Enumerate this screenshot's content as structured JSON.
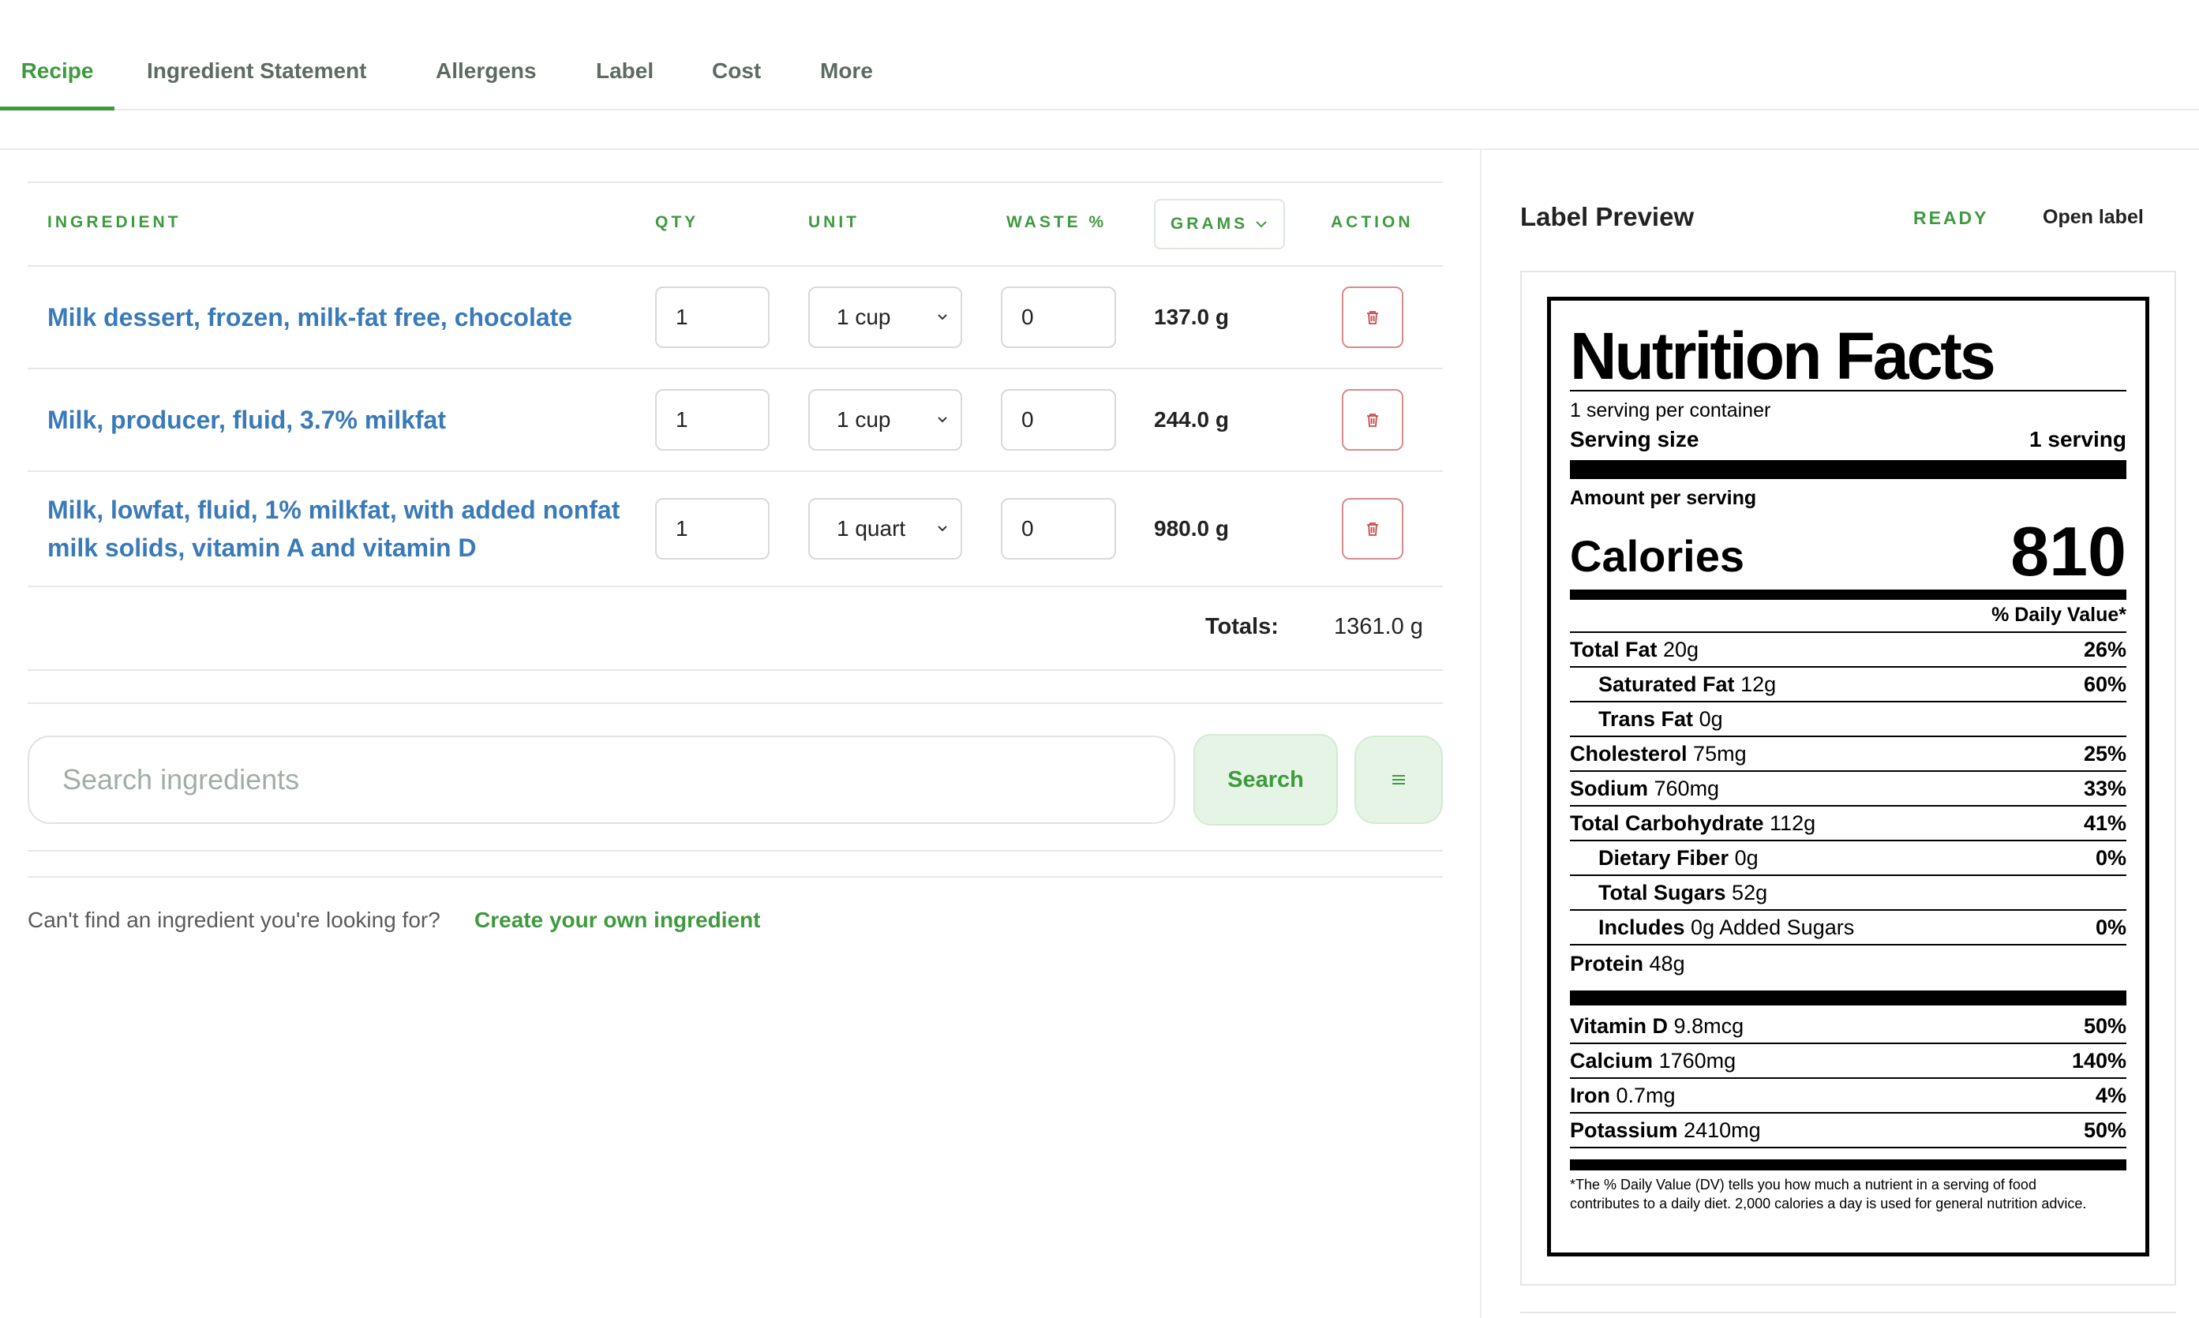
{
  "tabs": [
    {
      "label": "Recipe",
      "active": true
    },
    {
      "label": "Ingredient Statement"
    },
    {
      "label": "Allergens"
    },
    {
      "label": "Label"
    },
    {
      "label": "Cost"
    },
    {
      "label": "More"
    }
  ],
  "table": {
    "headers": {
      "ingredient": "INGREDIENT",
      "qty": "QTY",
      "unit": "UNIT",
      "waste": "WASTE %",
      "grams": "GRAMS",
      "action": "ACTION"
    },
    "rows": [
      {
        "name": "Milk dessert, frozen, milk-fat free, chocolate",
        "qty": "1",
        "unit": "1 cup",
        "waste": "0",
        "grams": "137.0 g"
      },
      {
        "name": "Milk, producer, fluid, 3.7% milkfat",
        "qty": "1",
        "unit": "1 cup",
        "waste": "0",
        "grams": "244.0 g"
      },
      {
        "name_line1": "Milk, lowfat, fluid, 1% milkfat, with added nonfat",
        "name_line2": "milk solids, vitamin A and vitamin D",
        "qty": "1",
        "unit": "1 quart",
        "waste": "0",
        "grams": "980.0 g"
      }
    ],
    "totals_label": "Totals:",
    "totals_value": "1361.0 g"
  },
  "search": {
    "placeholder": "Search ingredients",
    "button_label": "Search"
  },
  "footer": {
    "prompt": "Can't find an ingredient you're looking for?",
    "link": "Create your own ingredient"
  },
  "preview": {
    "title": "Label Preview",
    "status": "READY",
    "open_label": "Open label"
  },
  "nutrition": {
    "title": "Nutrition Facts",
    "servings": "1 serving per container",
    "serving_size_label": "Serving size",
    "serving_size_value": "1 serving",
    "amount_per_serving": "Amount per serving",
    "calories_label": "Calories",
    "calories_value": "810",
    "dv_header": "% Daily Value*",
    "rows": [
      {
        "name": "Total Fat",
        "amount": "20g",
        "dv": "26%"
      },
      {
        "name": "Saturated Fat",
        "amount": "12g",
        "dv": "60%"
      },
      {
        "name": "Trans Fat",
        "amount": "0g",
        "dv": ""
      },
      {
        "name": "Cholesterol",
        "amount": "75mg",
        "dv": "25%"
      },
      {
        "name": "Sodium",
        "amount": "760mg",
        "dv": "33%"
      },
      {
        "name": "Total Carbohydrate",
        "amount": "112g",
        "dv": "41%"
      },
      {
        "name": "Dietary Fiber",
        "amount": "0g",
        "dv": "0%"
      },
      {
        "name": "Total Sugars",
        "amount": "52g",
        "dv": ""
      },
      {
        "name": "Includes",
        "amount": "0g Added Sugars",
        "dv": "0%"
      },
      {
        "name": "Protein",
        "amount": "48g",
        "dv": ""
      }
    ],
    "vitamins": [
      {
        "name": "Vitamin D",
        "amount": "9.8mcg",
        "dv": "50%"
      },
      {
        "name": "Calcium",
        "amount": "1760mg",
        "dv": "140%"
      },
      {
        "name": "Iron",
        "amount": "0.7mg",
        "dv": "4%"
      },
      {
        "name": "Potassium",
        "amount": "2410mg",
        "dv": "50%"
      }
    ],
    "footnote": "*The % Daily Value (DV) tells you how much a nutrient in a serving of food contributes to a daily diet. 2,000 calories a day is used for general nutrition advice."
  },
  "colors": {
    "accent": "#3f9a3f",
    "link": "#3a7ab8",
    "danger": "#c94a4a"
  }
}
